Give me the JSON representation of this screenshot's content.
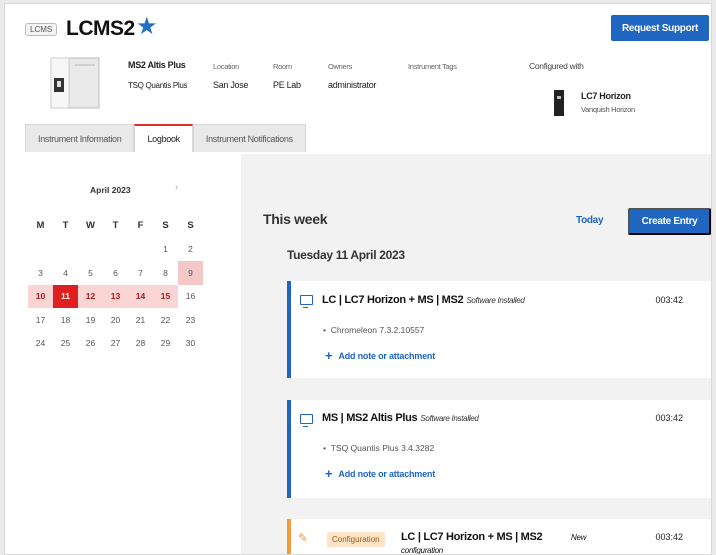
{
  "header": {
    "badge": "LCMS",
    "title": "LCMS2",
    "request_support": "Request Support"
  },
  "instrument": {
    "model": "MS2 Altis Plus",
    "submodel": "TSQ Quantis Plus",
    "location_label": "Location",
    "location": "San Jose",
    "room_label": "Room",
    "room": "PE Lab",
    "owners_label": "Owners",
    "owners": "administrator",
    "tags_label": "Instrument Tags",
    "configured_label": "Configured with",
    "configured_name": "LC7 Horizon",
    "configured_sub": "Vanquish Horizon"
  },
  "tabs": [
    {
      "label": "Instrument Information"
    },
    {
      "label": "Logbook"
    },
    {
      "label": "Instrument Notifications"
    }
  ],
  "calendar": {
    "month": "April 2023",
    "days_of_week": [
      "M",
      "T",
      "W",
      "T",
      "F",
      "S",
      "S"
    ],
    "rows": [
      [
        "",
        "",
        "",
        "",
        "",
        "1",
        "2"
      ],
      [
        "3",
        "4",
        "5",
        "6",
        "7",
        "8",
        "9"
      ],
      [
        "10",
        "11",
        "12",
        "13",
        "14",
        "15",
        "16"
      ],
      [
        "17",
        "18",
        "19",
        "20",
        "21",
        "22",
        "23"
      ],
      [
        "24",
        "25",
        "26",
        "27",
        "28",
        "29",
        "30"
      ]
    ],
    "today": "11",
    "highlighted_week": [
      "10",
      "11",
      "12",
      "13",
      "14",
      "15"
    ],
    "marked": [
      "9"
    ]
  },
  "logbook": {
    "week_title": "This week",
    "today_link": "Today",
    "create_entry": "Create Entry",
    "day_title": "Tuesday 11 April 2023",
    "entries": [
      {
        "title": "LC | LC7 Horizon + MS | MS2",
        "type": "Software Installed",
        "time": "003:42",
        "detail": "Chromeleon 7.3.2.10557",
        "add_note": "Add note or attachment"
      },
      {
        "title": "MS | MS2 Altis Plus",
        "type": "Software Installed",
        "time": "003:42",
        "detail": "TSQ Quantis Plus 3.4.3282",
        "add_note": "Add note or attachment"
      },
      {
        "tag": "Configuration",
        "title": "LC | LC7 Horizon + MS | MS2",
        "type_line1": "New",
        "type_line2": "configuration",
        "time": "003:42"
      }
    ]
  },
  "colors": {
    "accent": "#1f66c1",
    "today": "#e02020",
    "week_highlight": "#fbd4d4",
    "config": "#f39a3a"
  }
}
